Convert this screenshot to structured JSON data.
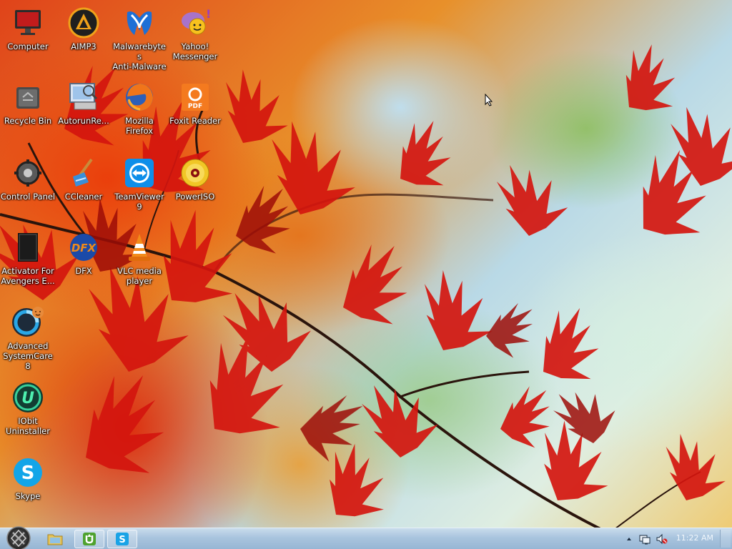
{
  "desktop": {
    "icons": [
      {
        "name": "computer-icon",
        "label": "Computer"
      },
      {
        "name": "aimp3-icon",
        "label": "AIMP3"
      },
      {
        "name": "malwarebytes-icon",
        "label": "Malwarebytes\nAnti-Malware"
      },
      {
        "name": "yahoo-messenger-icon",
        "label": "Yahoo!\nMessenger"
      },
      {
        "name": "recycle-bin-icon",
        "label": "Recycle Bin"
      },
      {
        "name": "autorunrecovery-icon",
        "label": "AutorunRe..."
      },
      {
        "name": "firefox-icon",
        "label": "Mozilla\nFirefox"
      },
      {
        "name": "foxit-reader-icon",
        "label": "Foxit Reader"
      },
      {
        "name": "control-panel-icon",
        "label": "Control Panel"
      },
      {
        "name": "ccleaner-icon",
        "label": "CCleaner"
      },
      {
        "name": "teamviewer-icon",
        "label": "TeamViewer 9"
      },
      {
        "name": "poweriso-icon",
        "label": "PowerISO"
      },
      {
        "name": "activator-icon",
        "label": "Activator For\nAvengers E..."
      },
      {
        "name": "dfx-icon",
        "label": "DFX"
      },
      {
        "name": "vlc-icon",
        "label": "VLC media\nplayer"
      },
      {
        "name": "advanced-systemcare-icon",
        "label": "Advanced\nSystemCare 8"
      },
      {
        "name": "iobit-uninstaller-icon",
        "label": "IObit\nUninstaller"
      },
      {
        "name": "skype-icon",
        "label": "Skype"
      }
    ]
  },
  "taskbar": {
    "start_icon": "avengers-shield-icon",
    "buttons": [
      {
        "name": "file-explorer-icon"
      },
      {
        "name": "utorrent-icon"
      },
      {
        "name": "skype-icon"
      }
    ],
    "tray": {
      "icons": [
        "show-hidden-icons-arrow",
        "network-icon",
        "volume-muted-icon"
      ],
      "clock": "11:22 AM"
    }
  },
  "colors": {
    "taskbar": "#a9c4de",
    "label_text": "#ffffff"
  }
}
